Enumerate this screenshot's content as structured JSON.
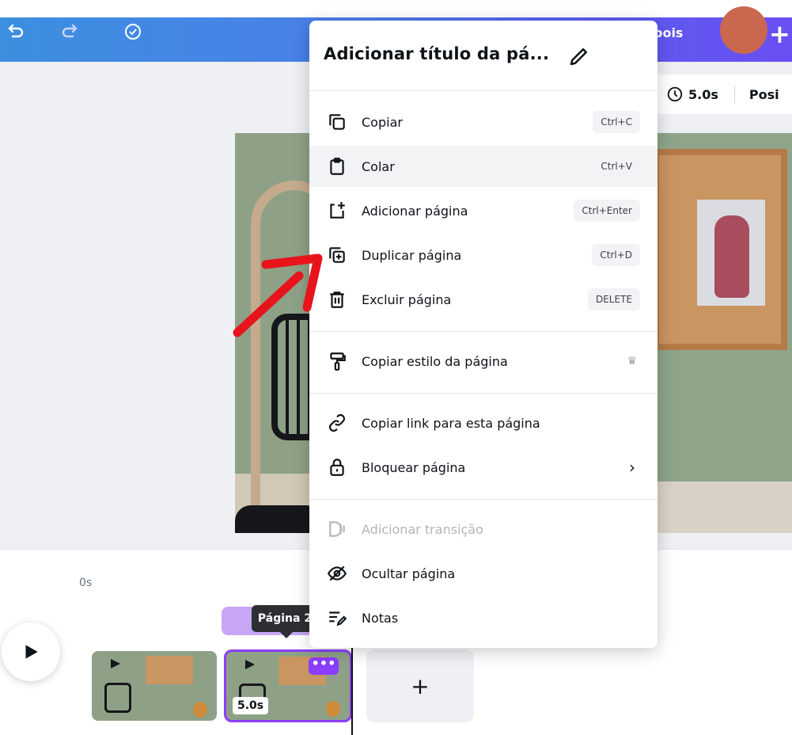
{
  "topbar": {
    "share_partial": "pois",
    "plus": "+"
  },
  "toolbar": {
    "duration": "5.0s",
    "position_partial": "Posi"
  },
  "menu": {
    "title": "Adicionar título da pá...",
    "items": [
      {
        "label": "Copiar",
        "shortcut": "Ctrl+C",
        "icon": "copy-icon"
      },
      {
        "label": "Colar",
        "shortcut": "Ctrl+V",
        "icon": "paste-icon"
      },
      {
        "label": "Adicionar página",
        "shortcut": "Ctrl+Enter",
        "icon": "add-page-icon"
      },
      {
        "label": "Duplicar página",
        "shortcut": "Ctrl+D",
        "icon": "duplicate-icon"
      },
      {
        "label": "Excluir página",
        "shortcut": "DELETE",
        "icon": "trash-icon"
      },
      {
        "label": "Copiar estilo da página",
        "icon": "paint-roller-icon",
        "badge": "crown-icon"
      },
      {
        "label": "Copiar link para esta página",
        "icon": "link-icon"
      },
      {
        "label": "Bloquear página",
        "icon": "lock-icon",
        "submenu": true
      },
      {
        "label": "Adicionar transição",
        "icon": "transition-icon",
        "disabled": true
      },
      {
        "label": "Ocultar página",
        "icon": "eye-slash-icon"
      },
      {
        "label": "Notas",
        "icon": "notes-icon"
      }
    ]
  },
  "timeline": {
    "start_time": "0s",
    "tooltip": "Página 2",
    "page2_duration": "5.0s",
    "more_dots": "•••",
    "add_page": "+"
  },
  "colors": {
    "accent": "#8b3dff",
    "topbar_start": "#3d8fe0",
    "topbar_end": "#6a4ff2",
    "arrow": "#e8141b"
  }
}
